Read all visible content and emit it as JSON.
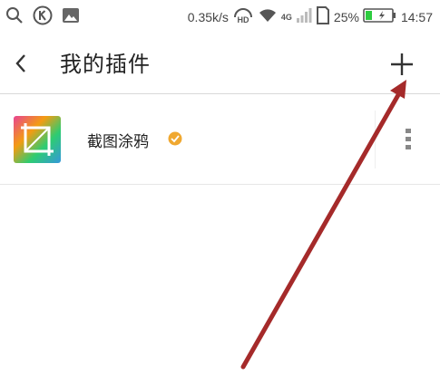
{
  "status_bar": {
    "network_speed": "0.35k/s",
    "network_type": "4G",
    "hd_label": "HD",
    "battery_percent": "25%",
    "battery_level": 0.25,
    "time": "14:57",
    "icons": [
      "search-icon",
      "k-circle-icon",
      "image-icon",
      "headset-hd-icon",
      "wifi-icon",
      "signal-icon",
      "sim-icon",
      "battery-icon"
    ]
  },
  "header": {
    "back_icon": "chevron-left-icon",
    "title": "我的插件",
    "add_icon": "plus-icon"
  },
  "plugins": [
    {
      "name": "截图涂鸦",
      "icon": "crop-icon",
      "verified": true,
      "menu_icon": "more-vertical-icon"
    }
  ],
  "colors": {
    "annotation_arrow": "#a52a2a",
    "badge": "#f0a830",
    "battery": "#2ecc40"
  }
}
